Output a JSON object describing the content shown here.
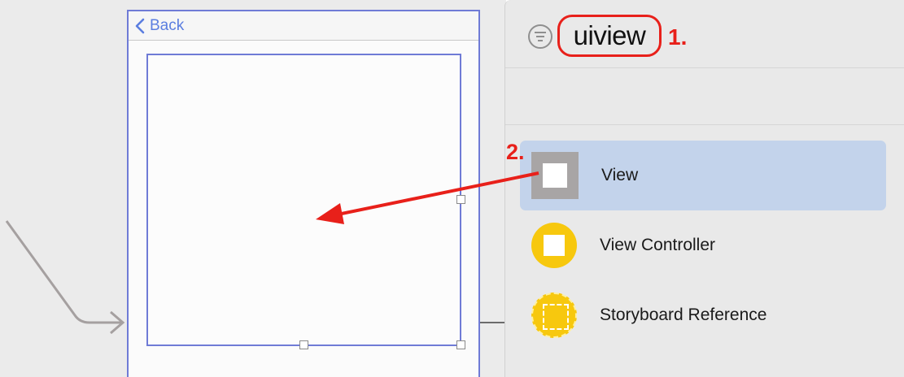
{
  "canvas": {
    "navbar": {
      "back_label": "Back"
    }
  },
  "library": {
    "search": {
      "value": "uiview"
    },
    "annotations": {
      "step1": "1.",
      "step2": "2."
    },
    "items": [
      {
        "label": "View",
        "icon": "view-icon",
        "selected": true
      },
      {
        "label": "View Controller",
        "icon": "view-controller-icon",
        "selected": false
      },
      {
        "label": "Storyboard Reference",
        "icon": "storyboard-reference-icon",
        "selected": false
      }
    ]
  },
  "colors": {
    "selection": "#c3d3eb",
    "annotation_red": "#e8201a",
    "outline_blue": "#6f7bd6",
    "object_yellow": "#f7c80e"
  }
}
